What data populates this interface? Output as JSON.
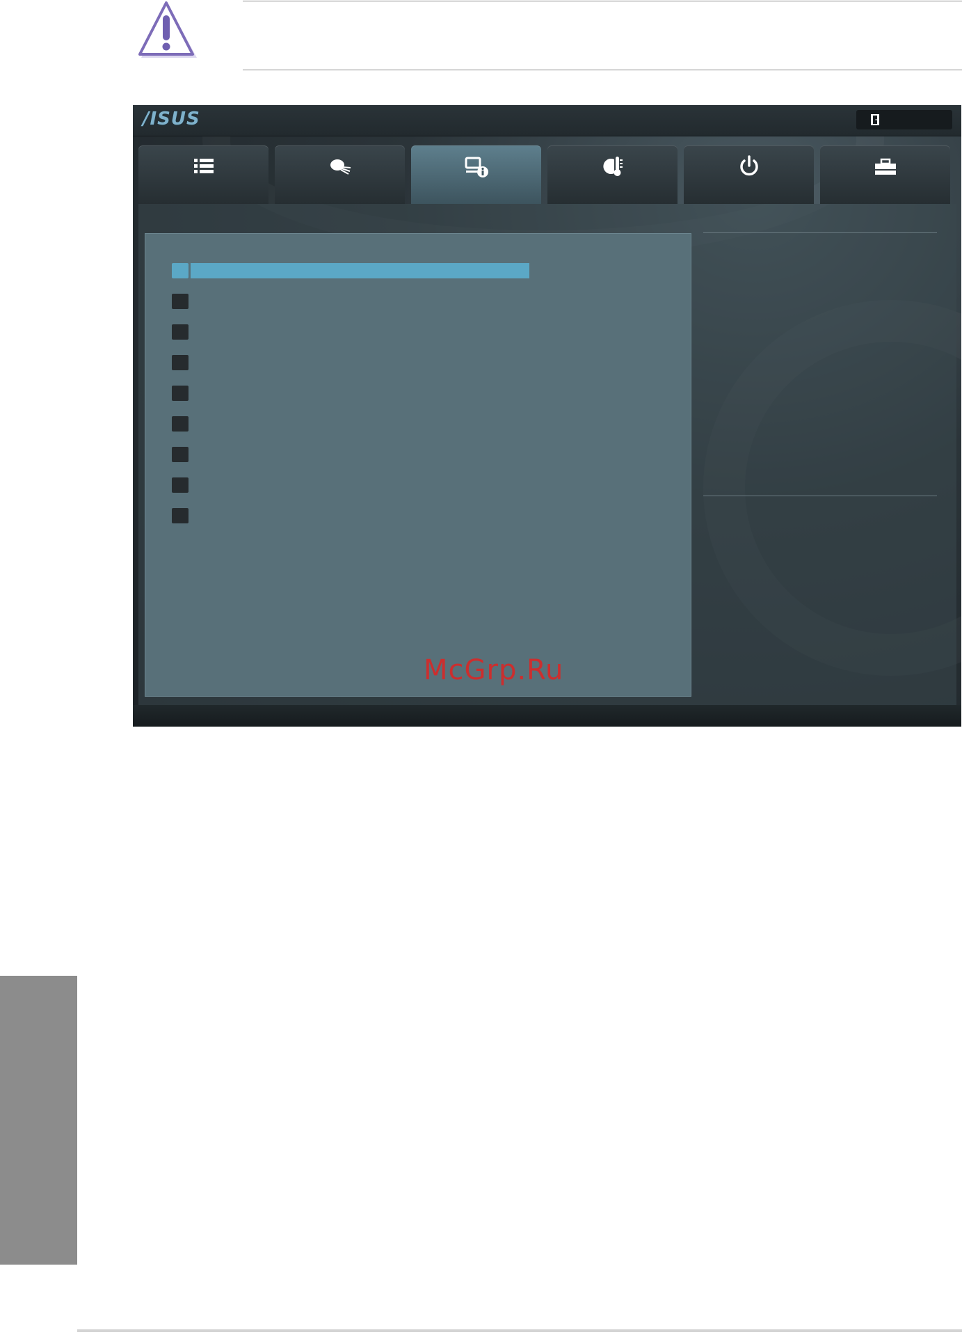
{
  "bios": {
    "brand": "/ISUS",
    "accent_color": "#5ba8c6",
    "tabs": [
      {
        "icon": "list-icon",
        "active": false
      },
      {
        "icon": "cpu-speed-icon",
        "active": false
      },
      {
        "icon": "system-info-icon",
        "active": true
      },
      {
        "icon": "temperature-icon",
        "active": false
      },
      {
        "icon": "power-icon",
        "active": false
      },
      {
        "icon": "toolbox-icon",
        "active": false
      }
    ],
    "menu_item_count": 8
  },
  "watermark": "McGrp.Ru"
}
